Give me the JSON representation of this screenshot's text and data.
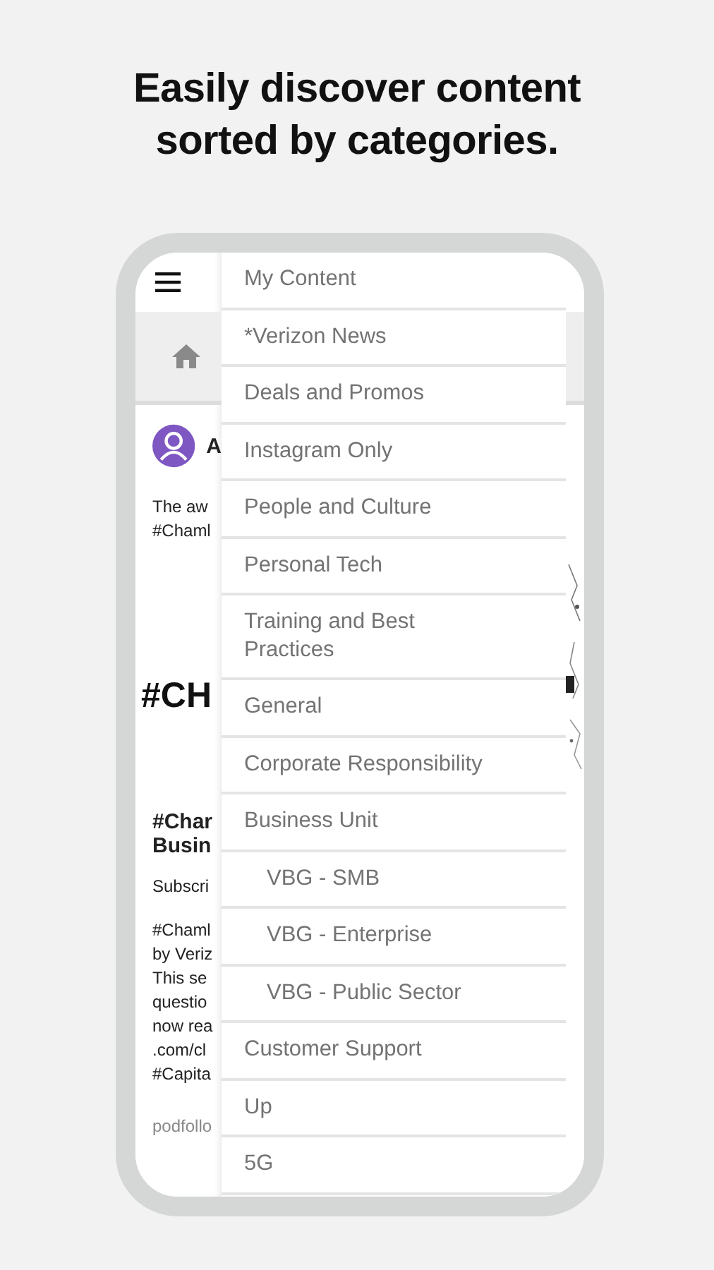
{
  "headline": [
    "Easily discover content",
    "sorted by categories."
  ],
  "post": {
    "author": "A",
    "intro": [
      "The aw",
      "#Chaml"
    ],
    "banner": "#CH",
    "title": [
      "#Char",
      "Busin"
    ],
    "subtitle": "Subscri",
    "body": [
      "#Chaml",
      "by Veriz",
      "This se",
      "questio",
      "now rea",
      ".com/cl",
      "#Capita"
    ],
    "source": "podfollo"
  },
  "menu": [
    {
      "label": "My Content",
      "kind": "top"
    },
    {
      "label": "*Verizon News",
      "kind": "top"
    },
    {
      "label": "Deals and Promos",
      "kind": "top"
    },
    {
      "label": "Instagram Only",
      "kind": "top"
    },
    {
      "label": "People and Culture",
      "kind": "top"
    },
    {
      "label": "Personal Tech",
      "kind": "top"
    },
    {
      "label": "Training and Best Practices",
      "kind": "top"
    },
    {
      "label": "General",
      "kind": "top"
    },
    {
      "label": "Corporate Responsibility",
      "kind": "top"
    },
    {
      "label": "Business Unit",
      "kind": "top"
    },
    {
      "label": "VBG - SMB",
      "kind": "sub"
    },
    {
      "label": "VBG - Enterprise",
      "kind": "sub"
    },
    {
      "label": "VBG - Public Sector",
      "kind": "sub"
    },
    {
      "label": "Customer Support",
      "kind": "top"
    },
    {
      "label": "Up",
      "kind": "top"
    },
    {
      "label": "5G",
      "kind": "top"
    }
  ]
}
